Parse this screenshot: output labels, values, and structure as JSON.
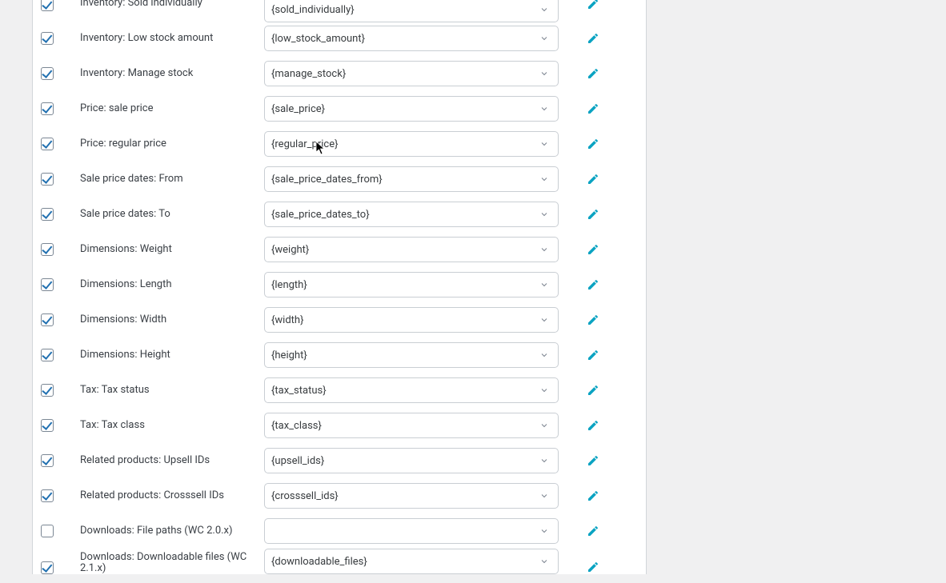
{
  "rows": [
    {
      "id": "sold-individually",
      "checked": true,
      "label": "Inventory: Sold individually",
      "value": "{sold_individually}"
    },
    {
      "id": "low-stock-amount",
      "checked": true,
      "label": "Inventory: Low stock amount",
      "value": "{low_stock_amount}"
    },
    {
      "id": "manage-stock",
      "checked": true,
      "label": "Inventory: Manage stock",
      "value": "{manage_stock}"
    },
    {
      "id": "sale-price",
      "checked": true,
      "label": "Price: sale price",
      "value": "{sale_price}"
    },
    {
      "id": "regular-price",
      "checked": true,
      "label": "Price: regular price",
      "value": "{regular_price}"
    },
    {
      "id": "sale-price-dates-from",
      "checked": true,
      "label": "Sale price dates: From",
      "value": "{sale_price_dates_from}"
    },
    {
      "id": "sale-price-dates-to",
      "checked": true,
      "label": "Sale price dates: To",
      "value": "{sale_price_dates_to}"
    },
    {
      "id": "weight",
      "checked": true,
      "label": "Dimensions: Weight",
      "value": "{weight}"
    },
    {
      "id": "length",
      "checked": true,
      "label": "Dimensions: Length",
      "value": "{length}"
    },
    {
      "id": "width",
      "checked": true,
      "label": "Dimensions: Width",
      "value": "{width}"
    },
    {
      "id": "height",
      "checked": true,
      "label": "Dimensions: Height",
      "value": "{height}"
    },
    {
      "id": "tax-status",
      "checked": true,
      "label": "Tax: Tax status",
      "value": "{tax_status}"
    },
    {
      "id": "tax-class",
      "checked": true,
      "label": "Tax: Tax class",
      "value": "{tax_class}"
    },
    {
      "id": "upsell-ids",
      "checked": true,
      "label": "Related products: Upsell IDs",
      "value": "{upsell_ids}"
    },
    {
      "id": "crosssell-ids",
      "checked": true,
      "label": "Related products: Crosssell IDs",
      "value": "{crosssell_ids}"
    },
    {
      "id": "file-paths",
      "checked": false,
      "label": "Downloads: File paths (WC 2.0.x)",
      "value": ""
    },
    {
      "id": "downloadable-files",
      "checked": true,
      "label": "Downloads: Downloadable files (WC 2.1.x)",
      "value": "{downloadable_files}"
    }
  ]
}
